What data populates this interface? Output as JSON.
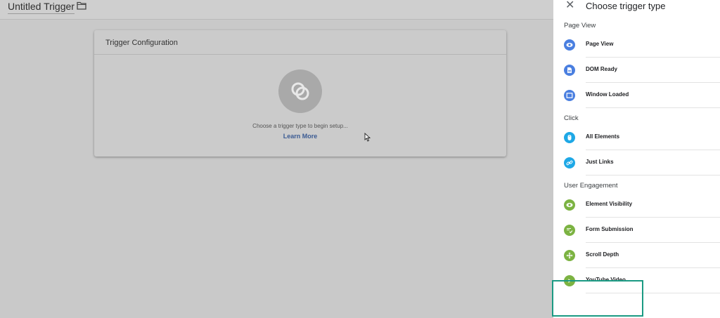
{
  "header": {
    "title": "Untitled Trigger",
    "folder_icon": "folder-icon"
  },
  "card": {
    "title": "Trigger Configuration",
    "hint": "Choose a trigger type to begin setup...",
    "learn_more": "Learn More"
  },
  "panel": {
    "title": "Choose trigger type",
    "sections": [
      {
        "title": "Page View",
        "items": [
          {
            "label": "Page View",
            "icon": "eye-icon",
            "color": "#4a7fe0"
          },
          {
            "label": "DOM Ready",
            "icon": "document-icon",
            "color": "#4a7fe0"
          },
          {
            "label": "Window Loaded",
            "icon": "window-icon",
            "color": "#4a7fe0"
          }
        ]
      },
      {
        "title": "Click",
        "items": [
          {
            "label": "All Elements",
            "icon": "mouse-icon",
            "color": "#1ea8e6"
          },
          {
            "label": "Just Links",
            "icon": "link-icon",
            "color": "#1ea8e6"
          }
        ]
      },
      {
        "title": "User Engagement",
        "items": [
          {
            "label": "Element Visibility",
            "icon": "eye-icon",
            "color": "#7cb342"
          },
          {
            "label": "Form Submission",
            "icon": "form-icon",
            "color": "#7cb342"
          },
          {
            "label": "Scroll Depth",
            "icon": "move-icon",
            "color": "#7cb342"
          },
          {
            "label": "YouTube Video",
            "icon": "play-icon",
            "color": "#7cb342"
          }
        ]
      }
    ]
  },
  "highlight_color": "#1b9a83"
}
